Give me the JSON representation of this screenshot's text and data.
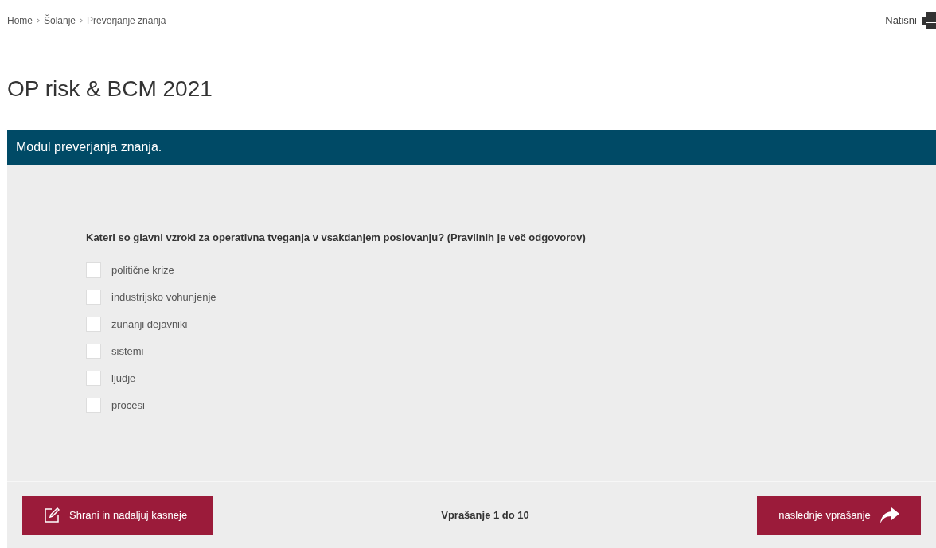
{
  "breadcrumb": [
    "Home",
    "Šolanje",
    "Preverjanje znanja"
  ],
  "print_link": "Natisni",
  "title": "OP risk & BCM 2021",
  "panel_header": "Modul preverjanja znanja.",
  "question": "Kateri so glavni vzroki za operativna tveganja v vsakdanjem poslovanju? (Pravilnih je več odgovorov)",
  "options": [
    {
      "label": "politične krize",
      "checked": false
    },
    {
      "label": "industrijsko vohunjenje",
      "checked": false
    },
    {
      "label": "zunanji dejavniki",
      "checked": false
    },
    {
      "label": "sistemi",
      "checked": false
    },
    {
      "label": "ljudje",
      "checked": false
    },
    {
      "label": "procesi",
      "checked": false
    }
  ],
  "footer": {
    "save_button": "Shrani in nadaljuj kasneje",
    "progress": "Vprašanje 1 do 10",
    "next_button": "naslednje vprašanje"
  }
}
